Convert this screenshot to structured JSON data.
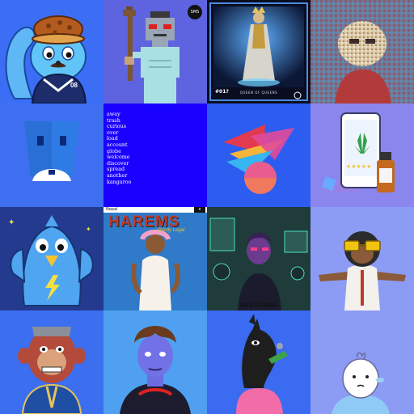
{
  "tiles": [
    {
      "id": "squirrel",
      "jersey": "08"
    },
    {
      "id": "pixel-skeleton",
      "badge": "SMS"
    },
    {
      "id": "queen-card",
      "card_number": "#01?",
      "caption": "QUEEN OF QUEENS"
    },
    {
      "id": "mosaic-ape"
    },
    {
      "id": "blue-logo"
    },
    {
      "id": "word-list",
      "words": [
        "away",
        "trash",
        "curious",
        "over",
        "load",
        "account",
        "globe",
        "welcome",
        "discover",
        "spread",
        "another",
        "kangaroo"
      ]
    },
    {
      "id": "paper-shapes"
    },
    {
      "id": "cannabis-phone"
    },
    {
      "id": "lightning-bird"
    },
    {
      "id": "harems-cover",
      "title": "HAREMS",
      "subtitle": "Strictly Legal",
      "bar_label": "Nepal",
      "bar_button": "x"
    },
    {
      "id": "cyber-figure",
      "text": "MISTRANI"
    },
    {
      "id": "gold-glasses-ape"
    },
    {
      "id": "red-ape"
    },
    {
      "id": "blue-hero"
    },
    {
      "id": "horse-pink"
    },
    {
      "id": "baby-boy"
    }
  ],
  "colors": {
    "page_bg": "#5b6cf0",
    "tile_blue": "#1a00ff",
    "tile_periwinkle": "#8c9cf5"
  }
}
